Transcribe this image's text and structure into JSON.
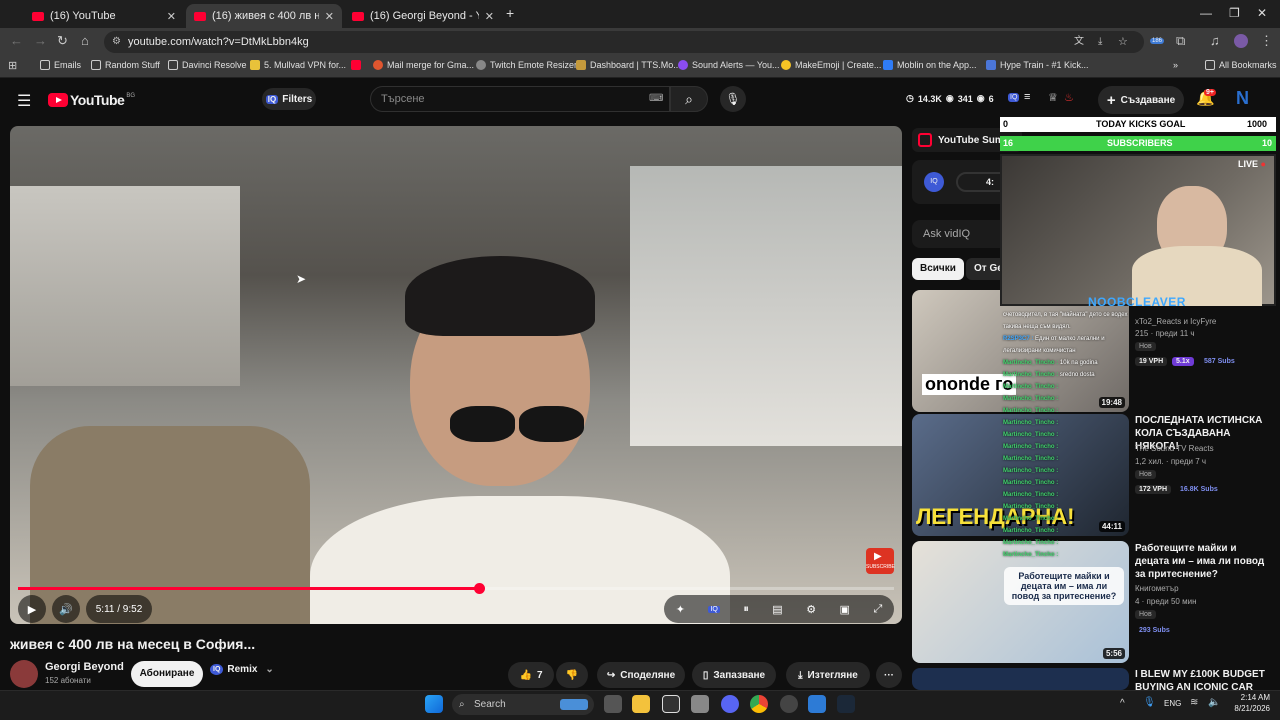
{
  "browser": {
    "tabs": [
      {
        "title": "(16) YouTube",
        "active": false
      },
      {
        "title": "(16) живея с 400 лв на месе",
        "active": true
      },
      {
        "title": "(16) Georgi Beyond - YouTube",
        "active": false
      }
    ],
    "new_tab": "+",
    "url": "youtube.com/watch?v=DtMkLbbn4kg",
    "bookmarks": [
      "Emails",
      "Random Stuff",
      "Davinci Resolve",
      "5. Mullvad VPN for...",
      "Mail merge for Gma...",
      "Twitch Emote Resizer",
      "Dashboard | TTS.Mo...",
      "Sound Alerts — You...",
      "MakeEmoji | Create...",
      "Moblin on the App...",
      "Hype Train - #1 Kick..."
    ],
    "all_bookmarks": "All Bookmarks",
    "ext_badge": "186"
  },
  "youtube": {
    "logo": "YouTube",
    "country": "BG",
    "filters": "Filters",
    "search_placeholder": "Търсене",
    "stats": {
      "views": "14.3K",
      "b": "341",
      "c": "6"
    },
    "create": "Създаване",
    "notifications": "9+",
    "video": {
      "time": "5:11 / 9:52",
      "progress": 0.526
    },
    "title": "живея с 400 лв на месец в София...",
    "channel": "Georgi Beyond",
    "subscribers": "152 абонати",
    "subscribe": "Абониране",
    "remix": "Remix",
    "likes": "7",
    "share": "Споделяне",
    "save": "Запазване",
    "download": "Изтегляне",
    "sidebar": {
      "summary": "YouTube Sum",
      "viq_short": "4:",
      "ask": "Ask vidIQ",
      "chips": [
        "Всички",
        "От Ge"
      ],
      "recs": [
        {
          "title": "",
          "channel": "xTo2_Reacts и IcyFyre",
          "meta": "215 · преди 11 ч",
          "badge": "Нов",
          "vph": "19 VPH",
          "mult": "5.1x",
          "subs": "587 Subs",
          "duration": "19:48",
          "thumb_text": "ononde го"
        },
        {
          "title": "ПОСЛЕДНАТА ИСТИНСКА КОЛА СЪЗДАВАНА НЯКОГА!",
          "channel": "The Sound TV Reacts",
          "meta": "1,2 хил. · преди 7 ч",
          "badge": "Нов",
          "vph": "172 VPH",
          "subs": "16.8K Subs",
          "duration": "44:11",
          "thumb_text": "ЛЕГЕНДАРНА!"
        },
        {
          "title": "Работещите майки и децата им – има ли повод за притеснение?",
          "channel": "Книгометър",
          "meta": "4 · преди 50 мин",
          "badge": "Нов",
          "subs": "293 Subs",
          "duration": "5:56",
          "thumb_text": "Работещите майки и децата им – има ли повод за притеснение?"
        },
        {
          "title": "I BLEW MY £100K BUDGET BUYING AN ICONIC CAR",
          "channel": "",
          "meta": "",
          "badge": "",
          "duration": "",
          "thumb_text": ""
        }
      ]
    }
  },
  "stream_overlay": {
    "goal_label": "TODAY KICKS GOAL",
    "goal_min": "0",
    "goal_max": "1000",
    "subs_label": "SUBSCRIBERS",
    "subs_min": "16",
    "subs_max": "10",
    "live": "LIVE",
    "streamer": "NOOBCLEAVER",
    "chat": [
      {
        "user": "",
        "msg": "счетоводител, в тая \"майната\" дето се водех"
      },
      {
        "user": "",
        "msg": "такива неща съм видял."
      },
      {
        "user": "R2SP3C7",
        "msg": "Един от малко легални и"
      },
      {
        "user": "",
        "msg": "легализирани комичистан"
      },
      {
        "user": "Martincho_Tincho",
        "msg": "10k na godina"
      },
      {
        "user": "Martincho_Tincho",
        "msg": "sredno dosta"
      },
      {
        "user": "Martincho_Tincho",
        "msg": ""
      },
      {
        "user": "Martincho_Tincho",
        "msg": ""
      },
      {
        "user": "Martincho_Tincho",
        "msg": ""
      },
      {
        "user": "Martincho_Tincho",
        "msg": ""
      },
      {
        "user": "Martincho_Tincho",
        "msg": ""
      },
      {
        "user": "Martincho_Tincho",
        "msg": ""
      },
      {
        "user": "Martincho_Tincho",
        "msg": ""
      },
      {
        "user": "Martincho_Tincho",
        "msg": ""
      },
      {
        "user": "Martincho_Tincho",
        "msg": ""
      },
      {
        "user": "Martincho_Tincho",
        "msg": ""
      },
      {
        "user": "Martincho_Tincho",
        "msg": ""
      },
      {
        "user": "Martincho_Tincho",
        "msg": ""
      },
      {
        "user": "Martincho_Tincho",
        "msg": ""
      },
      {
        "user": "Martincho_Tincho",
        "msg": ""
      },
      {
        "user": "Martincho_Tincho",
        "msg": ""
      }
    ]
  },
  "taskbar": {
    "search": "Search",
    "lang": "ENG",
    "time": "2:14 AM",
    "date": "8/21/2026"
  },
  "colors": {
    "youtube_red": "#ff0033",
    "subs_green": "#3fd24a",
    "background": "#0f0f0f"
  }
}
